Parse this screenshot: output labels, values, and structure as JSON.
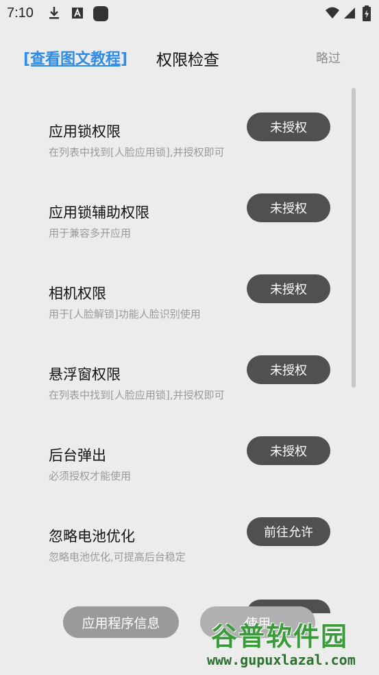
{
  "status_bar": {
    "time": "7:10"
  },
  "header": {
    "tutorial_link": "[查看图文教程]",
    "title": "权限检查",
    "skip": "略过"
  },
  "permissions": [
    {
      "title": "应用锁权限",
      "desc": "在列表中找到[人脸应用锁],并授权即可",
      "button": "未授权"
    },
    {
      "title": "应用锁辅助权限",
      "desc": "用于兼容多开应用",
      "button": "未授权"
    },
    {
      "title": "相机权限",
      "desc": "用于[人脸解锁]功能人脸识别使用",
      "button": "未授权"
    },
    {
      "title": "悬浮窗权限",
      "desc": "在列表中找到[人脸应用锁],并授权即可",
      "button": "未授权"
    },
    {
      "title": "后台弹出",
      "desc": "必须授权才能使用",
      "button": "未授权"
    },
    {
      "title": "忽略电池优化",
      "desc": "忽略电池优化,可提高后台稳定",
      "button": "前往允许"
    }
  ],
  "bottom": {
    "app_info": "应用程序信息",
    "use": "使用"
  },
  "watermark": {
    "name": "谷普软件园",
    "url": "www.gupuxlazal.com"
  }
}
